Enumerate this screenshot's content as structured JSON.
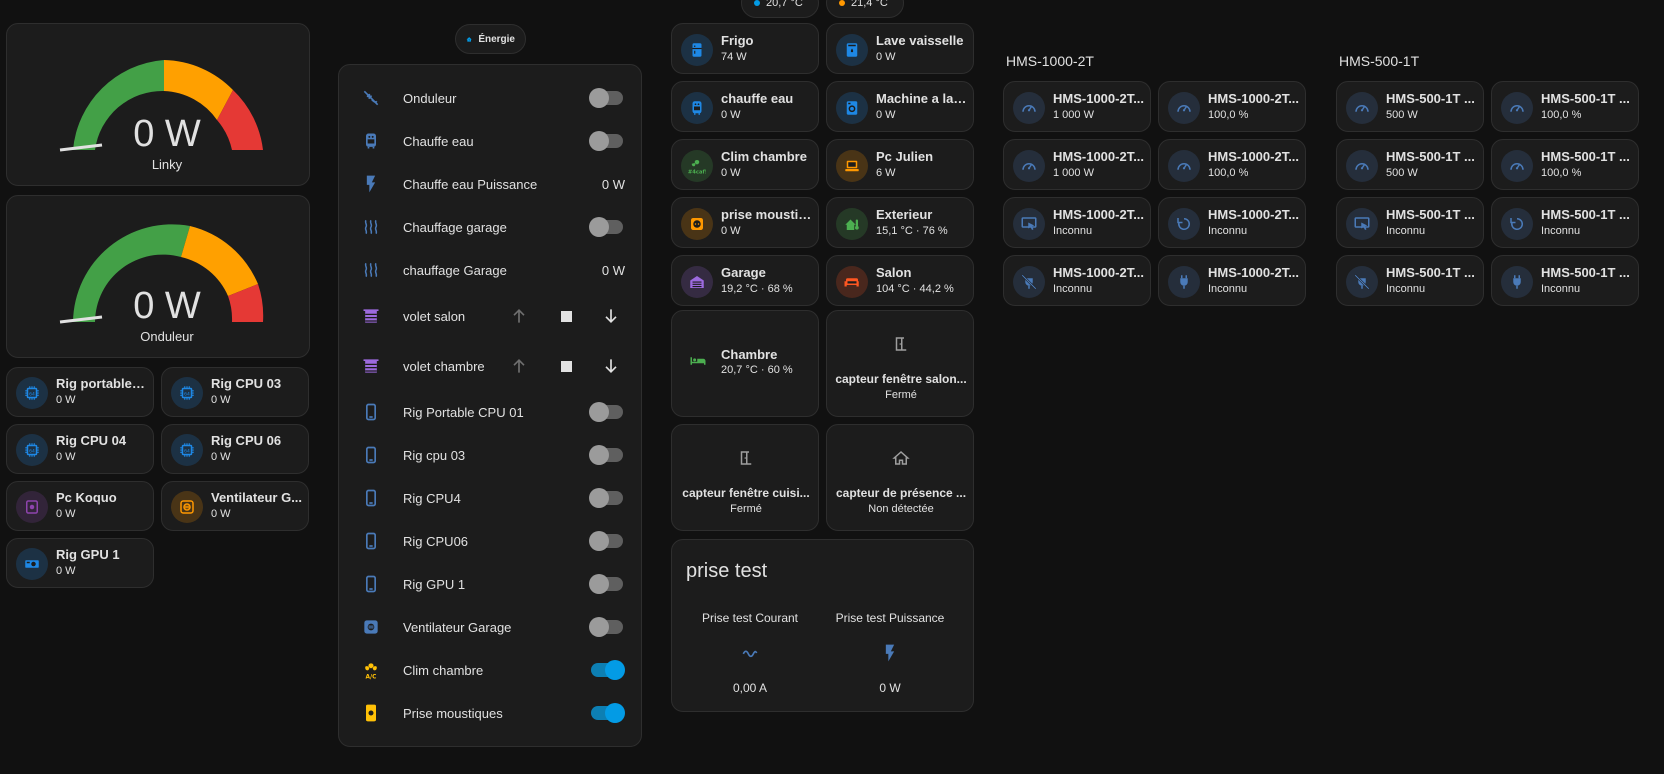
{
  "top_chips": [
    {
      "value": "20,7 °C",
      "dot_color": "#039be5"
    },
    {
      "value": "21,4 °C",
      "dot_color": "#ff9800"
    }
  ],
  "gauges": [
    {
      "value": "0 W",
      "name": "Linky",
      "level": 0
    },
    {
      "value": "0 W",
      "name": "Onduleur",
      "level": 0
    }
  ],
  "left_tiles": [
    {
      "name": "Rig portable c...",
      "state": "0 W",
      "icon": "cpu-icon",
      "color": "#1e88e5"
    },
    {
      "name": "Rig CPU 03",
      "state": "0 W",
      "icon": "cpu-icon",
      "color": "#1e88e5"
    },
    {
      "name": "Rig CPU 04",
      "state": "0 W",
      "icon": "cpu-icon",
      "color": "#1e88e5"
    },
    {
      "name": "Rig CPU 06",
      "state": "0 W",
      "icon": "cpu-icon",
      "color": "#1e88e5"
    },
    {
      "name": "Pc Koquo",
      "state": "0 W",
      "icon": "desktop-icon",
      "color": "#8e44ad"
    },
    {
      "name": "Ventilateur G...",
      "state": "0 W",
      "icon": "fan-icon",
      "color": "#ff9800"
    },
    {
      "name": "Rig GPU 1",
      "state": "0 W",
      "icon": "gpu-icon",
      "color": "#1e88e5"
    }
  ],
  "energy_chip": {
    "label": "Énergie"
  },
  "entities": [
    {
      "label": "Onduleur",
      "icon": "power-off-icon",
      "type": "toggle",
      "on": false
    },
    {
      "label": "Chauffe eau",
      "icon": "water-heater-icon",
      "type": "toggle",
      "on": false
    },
    {
      "label": "Chauffe eau Puissance",
      "icon": "flash-icon",
      "type": "value",
      "value": "0 W"
    },
    {
      "label": "Chauffage garage",
      "icon": "heat-wave-icon",
      "type": "toggle",
      "on": false
    },
    {
      "label": "chauffage Garage",
      "icon": "heat-wave-icon",
      "type": "value",
      "value": "0 W"
    },
    {
      "label": "volet salon",
      "icon": "shutter-icon",
      "type": "cover"
    },
    {
      "label": "volet chambre",
      "icon": "shutter-icon",
      "type": "cover"
    },
    {
      "label": "Rig Portable CPU 01",
      "icon": "phone-icon",
      "type": "toggle",
      "on": false
    },
    {
      "label": "Rig cpu 03",
      "icon": "phone-icon",
      "type": "toggle",
      "on": false
    },
    {
      "label": "Rig CPU4",
      "icon": "phone-icon",
      "type": "toggle",
      "on": false
    },
    {
      "label": "Rig CPU06",
      "icon": "phone-icon",
      "type": "toggle",
      "on": false
    },
    {
      "label": "Rig GPU 1",
      "icon": "phone-icon",
      "type": "toggle",
      "on": false
    },
    {
      "label": "Ventilateur Garage",
      "icon": "fan-icon",
      "type": "toggle",
      "on": false
    },
    {
      "label": "Clim chambre",
      "icon": "air-conditioner-icon",
      "type": "toggle",
      "on": true
    },
    {
      "label": "Prise moustiques",
      "icon": "plug-icon",
      "type": "toggle",
      "on": true
    }
  ],
  "mid_tiles": [
    {
      "name": "Frigo",
      "state": "74 W",
      "icon": "fridge-icon",
      "color": "#1e88e5"
    },
    {
      "name": "Lave vaisselle",
      "state": "0 W",
      "icon": "dishwasher-icon",
      "color": "#1e88e5"
    },
    {
      "name": "chauffe eau",
      "state": "0 W",
      "icon": "water-heater-icon",
      "color": "#1e88e5"
    },
    {
      "name": "Machine a lav...",
      "state": "0 W",
      "icon": "washing-machine-icon",
      "color": "#1e88e5"
    },
    {
      "name": "Clim chambre",
      "state": "0 W",
      "icon": "air-conditioner-icon",
      "color": "#4caf50"
    },
    {
      "name": "Pc Julien",
      "state": "6 W",
      "icon": "laptop-icon",
      "color": "#ff9800"
    },
    {
      "name": "prise moustiq...",
      "state": "0 W",
      "icon": "socket-icon",
      "color": "#ff9800"
    },
    {
      "name": "Exterieur",
      "state": "15,1 °C · 76 %",
      "icon": "home-thermometer-icon",
      "color": "#4caf50"
    },
    {
      "name": "Garage",
      "state": "19,2 °C · 68 %",
      "icon": "garage-icon",
      "color": "#9c6ade"
    },
    {
      "name": "Salon",
      "state": "104 °C · 44,2 %",
      "icon": "sofa-icon",
      "color": "#ff5722"
    }
  ],
  "chambre": {
    "name": "Chambre",
    "state": "20,7 °C · 60 %",
    "icon": "bed-icon",
    "color": "#4caf50"
  },
  "sensors": [
    {
      "name": "capteur fenêtre salon...",
      "state": "Fermé",
      "icon": "door-icon"
    },
    {
      "name": "capteur fenêtre cuisi...",
      "state": "Fermé",
      "icon": "door-icon"
    },
    {
      "name": "capteur de présence ...",
      "state": "Non détectée",
      "icon": "home-outline-icon"
    }
  ],
  "prise_test": {
    "title": "prise test",
    "items": [
      {
        "label": "Prise test Courant",
        "value": "0,00 A",
        "icon": "current-ac-icon"
      },
      {
        "label": "Prise test Puissance",
        "value": "0 W",
        "icon": "flash-icon"
      }
    ]
  },
  "hms1000": {
    "title": "HMS-1000-2T",
    "tiles": [
      {
        "name": "HMS-1000-2T...",
        "state": "1 000 W",
        "icon": "gauge-icon"
      },
      {
        "name": "HMS-1000-2T...",
        "state": "100,0 %",
        "icon": "gauge-icon"
      },
      {
        "name": "HMS-1000-2T...",
        "state": "1 000 W",
        "icon": "gauge-icon"
      },
      {
        "name": "HMS-1000-2T...",
        "state": "100,0 %",
        "icon": "gauge-icon"
      },
      {
        "name": "HMS-1000-2T...",
        "state": "Inconnu",
        "icon": "monitor-cursor-icon"
      },
      {
        "name": "HMS-1000-2T...",
        "state": "Inconnu",
        "icon": "restart-icon"
      },
      {
        "name": "HMS-1000-2T...",
        "state": "Inconnu",
        "icon": "power-plug-off-icon"
      },
      {
        "name": "HMS-1000-2T...",
        "state": "Inconnu",
        "icon": "power-plug-icon"
      }
    ]
  },
  "hms500": {
    "title": "HMS-500-1T",
    "tiles": [
      {
        "name": "HMS-500-1T ...",
        "state": "500 W",
        "icon": "gauge-icon"
      },
      {
        "name": "HMS-500-1T ...",
        "state": "100,0 %",
        "icon": "gauge-icon"
      },
      {
        "name": "HMS-500-1T ...",
        "state": "500 W",
        "icon": "gauge-icon"
      },
      {
        "name": "HMS-500-1T ...",
        "state": "100,0 %",
        "icon": "gauge-icon"
      },
      {
        "name": "HMS-500-1T ...",
        "state": "Inconnu",
        "icon": "monitor-cursor-icon"
      },
      {
        "name": "HMS-500-1T ...",
        "state": "Inconnu",
        "icon": "restart-icon"
      },
      {
        "name": "HMS-500-1T ...",
        "state": "Inconnu",
        "icon": "power-plug-off-icon"
      },
      {
        "name": "HMS-500-1T ...",
        "state": "Inconnu",
        "icon": "power-plug-icon"
      }
    ]
  }
}
